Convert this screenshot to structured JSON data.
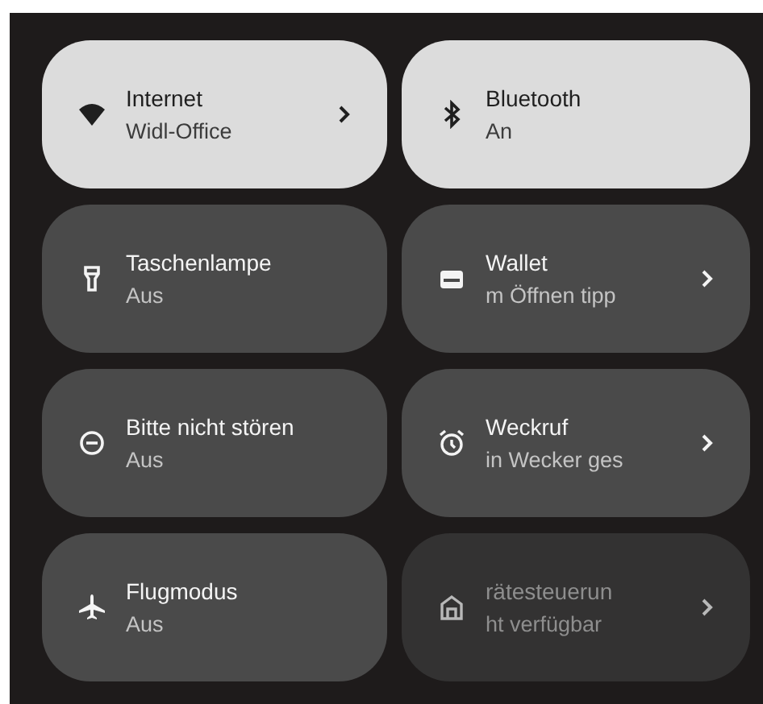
{
  "tiles": [
    {
      "title": "Internet",
      "subtitle": "Widl-Office",
      "on": true,
      "disabled": false,
      "chevron": true
    },
    {
      "title": "Bluetooth",
      "subtitle": "An",
      "on": true,
      "disabled": false,
      "chevron": false
    },
    {
      "title": "Taschenlampe",
      "subtitle": "Aus",
      "on": false,
      "disabled": false,
      "chevron": false
    },
    {
      "title": "Wallet",
      "subtitle": "m Öffnen tipp",
      "on": false,
      "disabled": false,
      "chevron": true
    },
    {
      "title": "Bitte nicht stören",
      "subtitle": "Aus",
      "on": false,
      "disabled": false,
      "chevron": false
    },
    {
      "title": "Weckruf",
      "subtitle": "in Wecker ges",
      "on": false,
      "disabled": false,
      "chevron": true
    },
    {
      "title": "Flugmodus",
      "subtitle": "Aus",
      "on": false,
      "disabled": false,
      "chevron": false
    },
    {
      "title": "rätesteuerun",
      "subtitle": "ht verfügbar",
      "on": false,
      "disabled": true,
      "chevron": true
    }
  ]
}
